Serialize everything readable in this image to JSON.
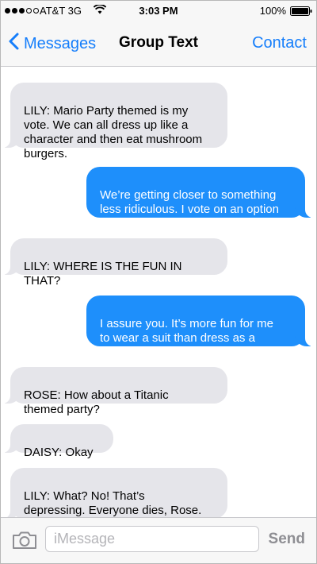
{
  "status_bar": {
    "carrier": "AT&T",
    "network": "3G",
    "time": "3:03 PM",
    "battery_percent": "100%",
    "signal_bars_filled": 3,
    "signal_bars_total": 5
  },
  "nav_bar": {
    "back_label": "Messages",
    "title": "Group Text",
    "contact_label": "Contact"
  },
  "messages": [
    {
      "direction": "incoming",
      "text": "LILY: Mario Party themed is my\nvote. We can all dress up like a\ncharacter and then eat mushroom\nburgers."
    },
    {
      "direction": "outgoing",
      "text": "We’re getting closer to something\nless ridiculous. I vote on an option\nwhere I can wear a suit."
    },
    {
      "direction": "incoming",
      "text": "LILY: WHERE IS THE FUN IN\nTHAT?"
    },
    {
      "direction": "outgoing",
      "text": "I assure you. It’s more fun for me\nto wear a suit than dress as a\ncartoon character."
    },
    {
      "direction": "incoming",
      "text": "ROSE: How about a Titanic\nthemed party?"
    },
    {
      "direction": "incoming",
      "text": "DAISY: Okay"
    },
    {
      "direction": "incoming",
      "text": "LILY: What? No! That’s\ndepressing. Everyone dies, Rose.\nEVERYONE."
    }
  ],
  "input_bar": {
    "placeholder": "iMessage",
    "value": "",
    "send_label": "Send"
  },
  "colors": {
    "accent": "#157efb",
    "outgoing_bubble": "#1e8ffb",
    "incoming_bubble": "#e5e5ea",
    "bar_background": "#f7f7f7"
  },
  "icons": {
    "back": "chevron-left-icon",
    "wifi": "wifi-icon",
    "battery": "battery-icon",
    "camera": "camera-icon"
  }
}
